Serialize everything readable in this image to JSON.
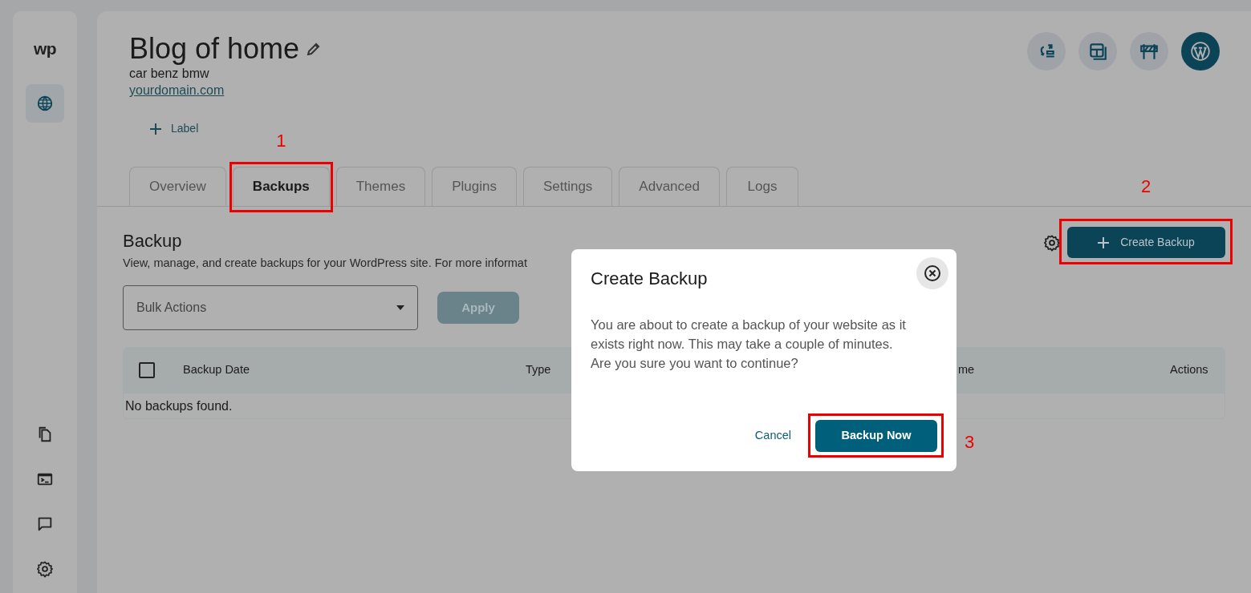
{
  "sidebar": {
    "logo": "wp",
    "items": [
      {
        "kind": "globe",
        "selected": true
      }
    ],
    "bottom_items": [
      {
        "kind": "copy",
        "selected": false
      },
      {
        "kind": "terminal",
        "selected": false
      },
      {
        "kind": "chat",
        "selected": false
      },
      {
        "kind": "settings",
        "selected": false
      }
    ]
  },
  "header": {
    "title": "Blog of home",
    "subtitle": "car benz bmw",
    "domain": "yourdomain.com",
    "add_label": "Label",
    "actions": [
      {
        "kind": "migrate",
        "filled": false
      },
      {
        "kind": "layout",
        "filled": false
      },
      {
        "kind": "staging",
        "filled": false
      },
      {
        "kind": "wordpress",
        "filled": true
      }
    ]
  },
  "tabs": [
    {
      "label": "Overview",
      "selected": false
    },
    {
      "label": "Backups",
      "selected": true,
      "annotation": "1"
    },
    {
      "label": "Themes",
      "selected": false
    },
    {
      "label": "Plugins",
      "selected": false
    },
    {
      "label": "Settings",
      "selected": false
    },
    {
      "label": "Advanced",
      "selected": false
    },
    {
      "label": "Logs",
      "selected": false
    }
  ],
  "section": {
    "heading": "Backup",
    "description": "View, manage, and create backups for your WordPress site. For more informat",
    "create_button": {
      "label": "Create Backup",
      "annotation": "2"
    },
    "bulk_select": {
      "placeholder": "Bulk Actions"
    },
    "apply_button": {
      "label": "Apply",
      "disabled": true
    }
  },
  "table": {
    "select_all_checked": false,
    "columns": [
      {
        "label": "Backup Date"
      },
      {
        "label": "Type"
      },
      {
        "label": "me"
      },
      {
        "label": "Actions"
      }
    ],
    "empty_text": "No backups found."
  },
  "dialog": {
    "title": "Create Backup",
    "body": "You are about to create a backup of your website as it exists right now. This may take a couple of minutes. Are you sure you want to continue?",
    "cancel": "Cancel",
    "confirm": {
      "label": "Backup Now",
      "annotation": "3"
    }
  }
}
